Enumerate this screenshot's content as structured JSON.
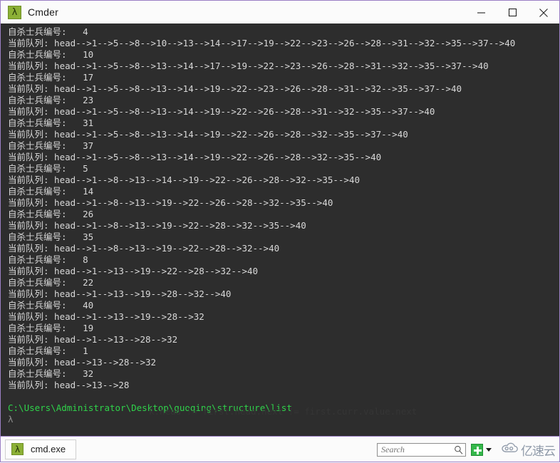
{
  "window": {
    "title": "Cmder",
    "icon": "lambda-icon",
    "icon_glyph": "λ",
    "accent_color": "#9b7fc4",
    "controls": [
      {
        "name": "minimize-button",
        "label": "Minimize"
      },
      {
        "name": "maximize-button",
        "label": "Maximize"
      },
      {
        "name": "close-button",
        "label": "Close"
      }
    ]
  },
  "terminal": {
    "background_color": "#2d2d2d",
    "foreground_color": "#d8d8d8",
    "prompt_color": "#2fd24a",
    "lines": [
      {
        "type": "out",
        "text": "自杀士兵编号:   4"
      },
      {
        "type": "out",
        "text": "当前队列: head-->1-->5-->8-->10-->13-->14-->17-->19-->22-->23-->26-->28-->31-->32-->35-->37-->40"
      },
      {
        "type": "out",
        "text": "自杀士兵编号:   10"
      },
      {
        "type": "out",
        "text": "当前队列: head-->1-->5-->8-->13-->14-->17-->19-->22-->23-->26-->28-->31-->32-->35-->37-->40"
      },
      {
        "type": "out",
        "text": "自杀士兵编号:   17"
      },
      {
        "type": "out",
        "text": "当前队列: head-->1-->5-->8-->13-->14-->19-->22-->23-->26-->28-->31-->32-->35-->37-->40"
      },
      {
        "type": "out",
        "text": "自杀士兵编号:   23"
      },
      {
        "type": "out",
        "text": "当前队列: head-->1-->5-->8-->13-->14-->19-->22-->26-->28-->31-->32-->35-->37-->40"
      },
      {
        "type": "out",
        "text": "自杀士兵编号:   31"
      },
      {
        "type": "out",
        "text": "当前队列: head-->1-->5-->8-->13-->14-->19-->22-->26-->28-->32-->35-->37-->40"
      },
      {
        "type": "out",
        "text": "自杀士兵编号:   37"
      },
      {
        "type": "out",
        "text": "当前队列: head-->1-->5-->8-->13-->14-->19-->22-->26-->28-->32-->35-->40"
      },
      {
        "type": "out",
        "text": "自杀士兵编号:   5"
      },
      {
        "type": "out",
        "text": "当前队列: head-->1-->8-->13-->14-->19-->22-->26-->28-->32-->35-->40"
      },
      {
        "type": "out",
        "text": "自杀士兵编号:   14"
      },
      {
        "type": "out",
        "text": "当前队列: head-->1-->8-->13-->19-->22-->26-->28-->32-->35-->40"
      },
      {
        "type": "out",
        "text": "自杀士兵编号:   26"
      },
      {
        "type": "out",
        "text": "当前队列: head-->1-->8-->13-->19-->22-->28-->32-->35-->40"
      },
      {
        "type": "out",
        "text": "自杀士兵编号:   35"
      },
      {
        "type": "out",
        "text": "当前队列: head-->1-->8-->13-->19-->22-->28-->32-->40"
      },
      {
        "type": "out",
        "text": "自杀士兵编号:   8"
      },
      {
        "type": "out",
        "text": "当前队列: head-->1-->13-->19-->22-->28-->32-->40"
      },
      {
        "type": "out",
        "text": "自杀士兵编号:   22"
      },
      {
        "type": "out",
        "text": "当前队列: head-->1-->13-->19-->28-->32-->40"
      },
      {
        "type": "out",
        "text": "自杀士兵编号:   40"
      },
      {
        "type": "out",
        "text": "当前队列: head-->1-->13-->19-->28-->32"
      },
      {
        "type": "out",
        "text": "自杀士兵编号:   19"
      },
      {
        "type": "out",
        "text": "当前队列: head-->1-->13-->28-->32"
      },
      {
        "type": "out",
        "text": "自杀士兵编号:   1"
      },
      {
        "type": "out",
        "text": "当前队列: head-->13-->28-->32"
      },
      {
        "type": "out",
        "text": "自杀士兵编号:   32"
      },
      {
        "type": "out",
        "text": "当前队列: head-->13-->28"
      },
      {
        "type": "blank",
        "text": " "
      },
      {
        "type": "prompt-path",
        "text": "C:\\Users\\Administrator\\Desktop\\guoqing\\structure\\list"
      },
      {
        "type": "prompt-lambda",
        "text": "λ"
      }
    ],
    "ghost_text": "k.head != first.head.next != first.curr.value.next"
  },
  "statusbar": {
    "tab": {
      "label": "cmd.exe",
      "icon": "lambda-icon",
      "icon_glyph": "λ"
    },
    "search": {
      "placeholder": "Search",
      "value": "",
      "icon": "search-icon"
    },
    "new_console": {
      "label": "+",
      "icon": "plus-icon",
      "color": "#35b84b"
    },
    "new_console_menu": {
      "icon": "chevron-down-icon"
    },
    "watermark": {
      "text": "亿速云",
      "icon": "cloud-icon",
      "color": "#8e99a8"
    }
  }
}
